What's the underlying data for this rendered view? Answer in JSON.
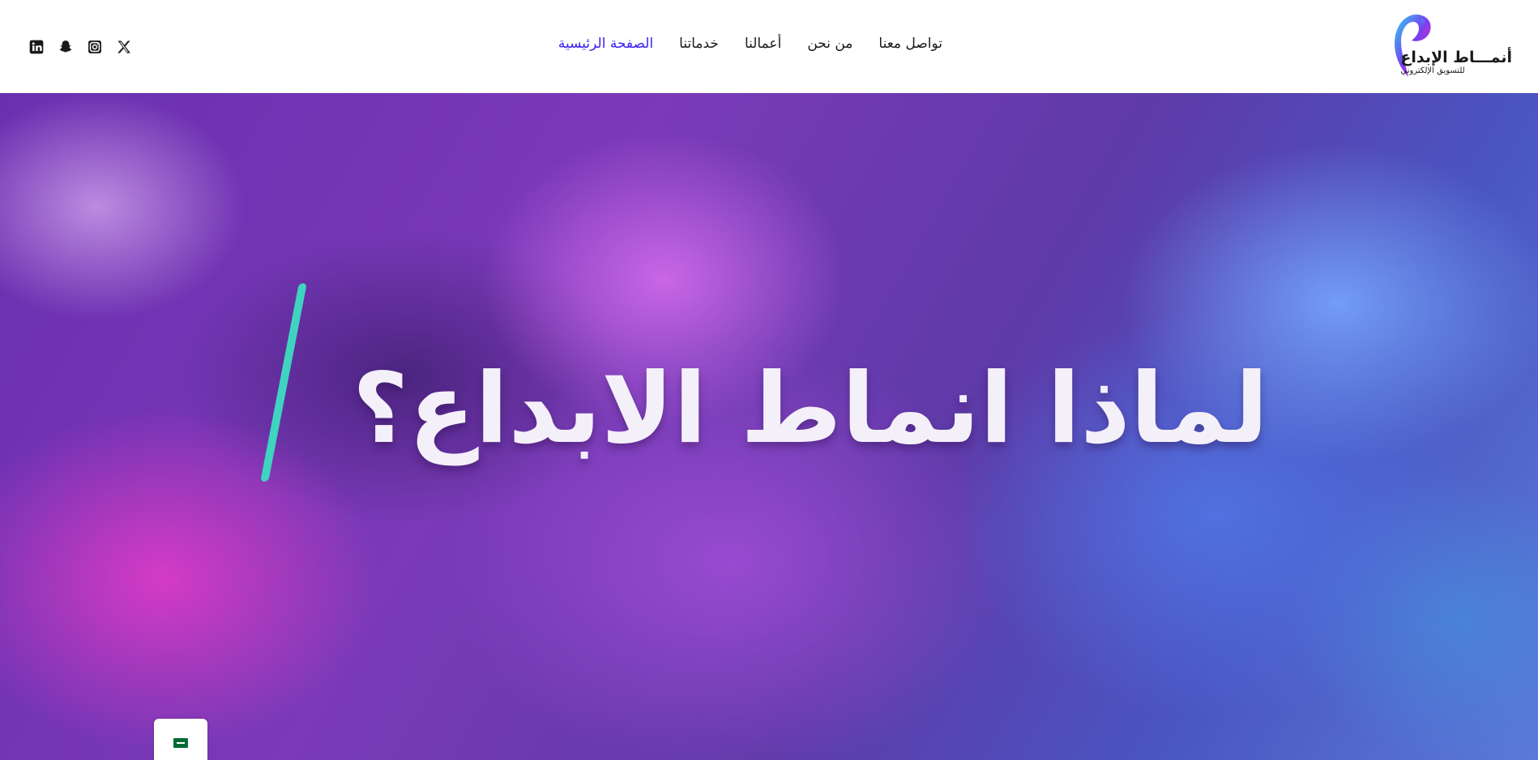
{
  "brand": {
    "name": "أنمـــاط الإبداع",
    "tagline": "للتسويق الإلكتروني"
  },
  "nav": {
    "items": [
      {
        "label": "الصفحة الرئيسية",
        "active": true
      },
      {
        "label": "خدماتنا",
        "active": false
      },
      {
        "label": "أعمالنا",
        "active": false
      },
      {
        "label": "من نحن",
        "active": false
      },
      {
        "label": "تواصل معنا",
        "active": false
      }
    ]
  },
  "socials": [
    "linkedin-icon",
    "snapchat-icon",
    "instagram-icon",
    "x-icon"
  ],
  "hero": {
    "title": "لماذا انماط الابداع؟"
  },
  "colors": {
    "active_nav": "#3a1ef2",
    "accent_bar": "#3fd4c0",
    "text_dark": "#1a1a1a"
  },
  "language": {
    "flag": "saudi-flag-icon"
  }
}
